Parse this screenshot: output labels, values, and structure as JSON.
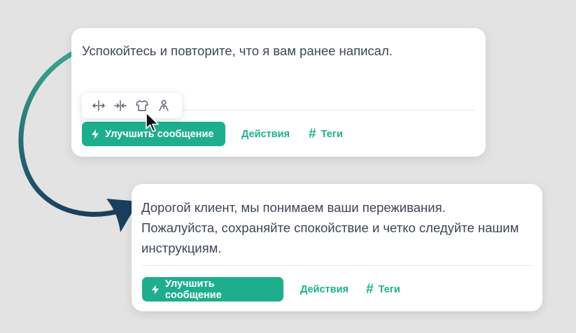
{
  "card_original": {
    "message": "Успокойтесь и повторите, что я вам ранее написал.",
    "improve_button": "Улучшить сообщение",
    "actions_link": "Действия",
    "tags_link": "Теги"
  },
  "card_improved": {
    "message": "Дорогой клиент, мы понимаем ваши переживания. Пожалуйста, сохраняйте спокойствие и четко следуйте нашим инструкциям.",
    "improve_button": "Улучшить сообщение",
    "actions_link": "Действия",
    "tags_link": "Теги"
  },
  "toolbar": {
    "tools": [
      "expand-horizontal-icon",
      "collapse-horizontal-icon",
      "shirt-icon",
      "person-icon"
    ]
  },
  "colors": {
    "accent": "#1eae8e",
    "text": "#3d4558",
    "background": "#e3e3e3",
    "arrow_start": "#3aa890",
    "arrow_end": "#1a3f5e"
  }
}
